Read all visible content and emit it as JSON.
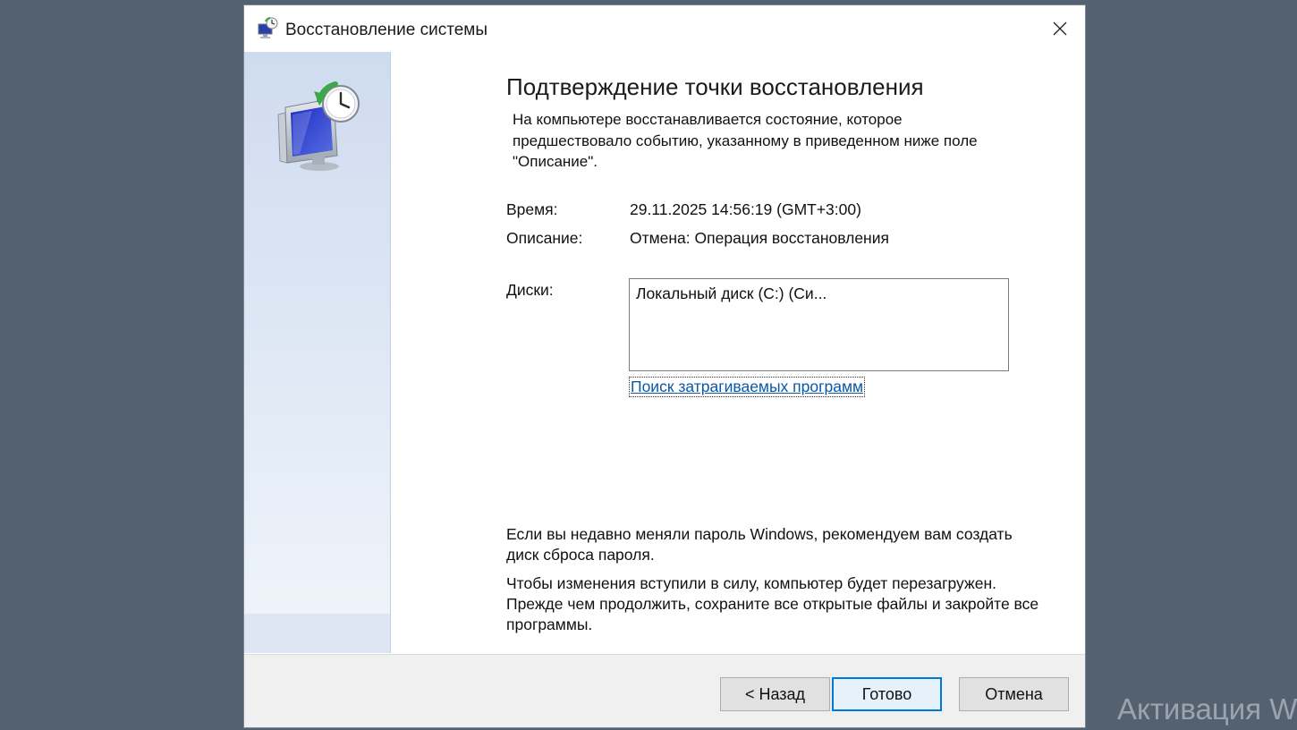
{
  "window": {
    "title": "Восстановление системы",
    "title_icon": "system-restore-icon",
    "close_icon": "close-icon"
  },
  "content": {
    "heading": "Подтверждение точки восстановления",
    "intro": "На компьютере восстанавливается состояние, которое предшествовало событию, указанному в приведенном ниже поле \"Описание\".",
    "details": {
      "time_label": "Время:",
      "time_value": "29.11.2025 14:56:19 (GMT+3:00)",
      "description_label": "Описание:",
      "description_value": "Отмена: Операция восстановления",
      "disks_label": "Диски:",
      "disks_value": "Локальный диск (C:) (Си..."
    },
    "affected_programs_link": "Поиск затрагиваемых программ",
    "password_note": "Если вы недавно меняли пароль Windows, рекомендуем вам создать диск сброса пароля.",
    "restart_note": "Чтобы изменения вступили в силу, компьютер будет перезагружен. Прежде чем продолжить, сохраните все открытые файлы и закройте все программы."
  },
  "buttons": {
    "back": "< Назад",
    "finish": "Готово",
    "cancel": "Отмена"
  },
  "desktop": {
    "watermark": "Активация W"
  },
  "colors": {
    "accent": "#0078d7",
    "link": "#0a58a6",
    "desktop": "#546171"
  }
}
